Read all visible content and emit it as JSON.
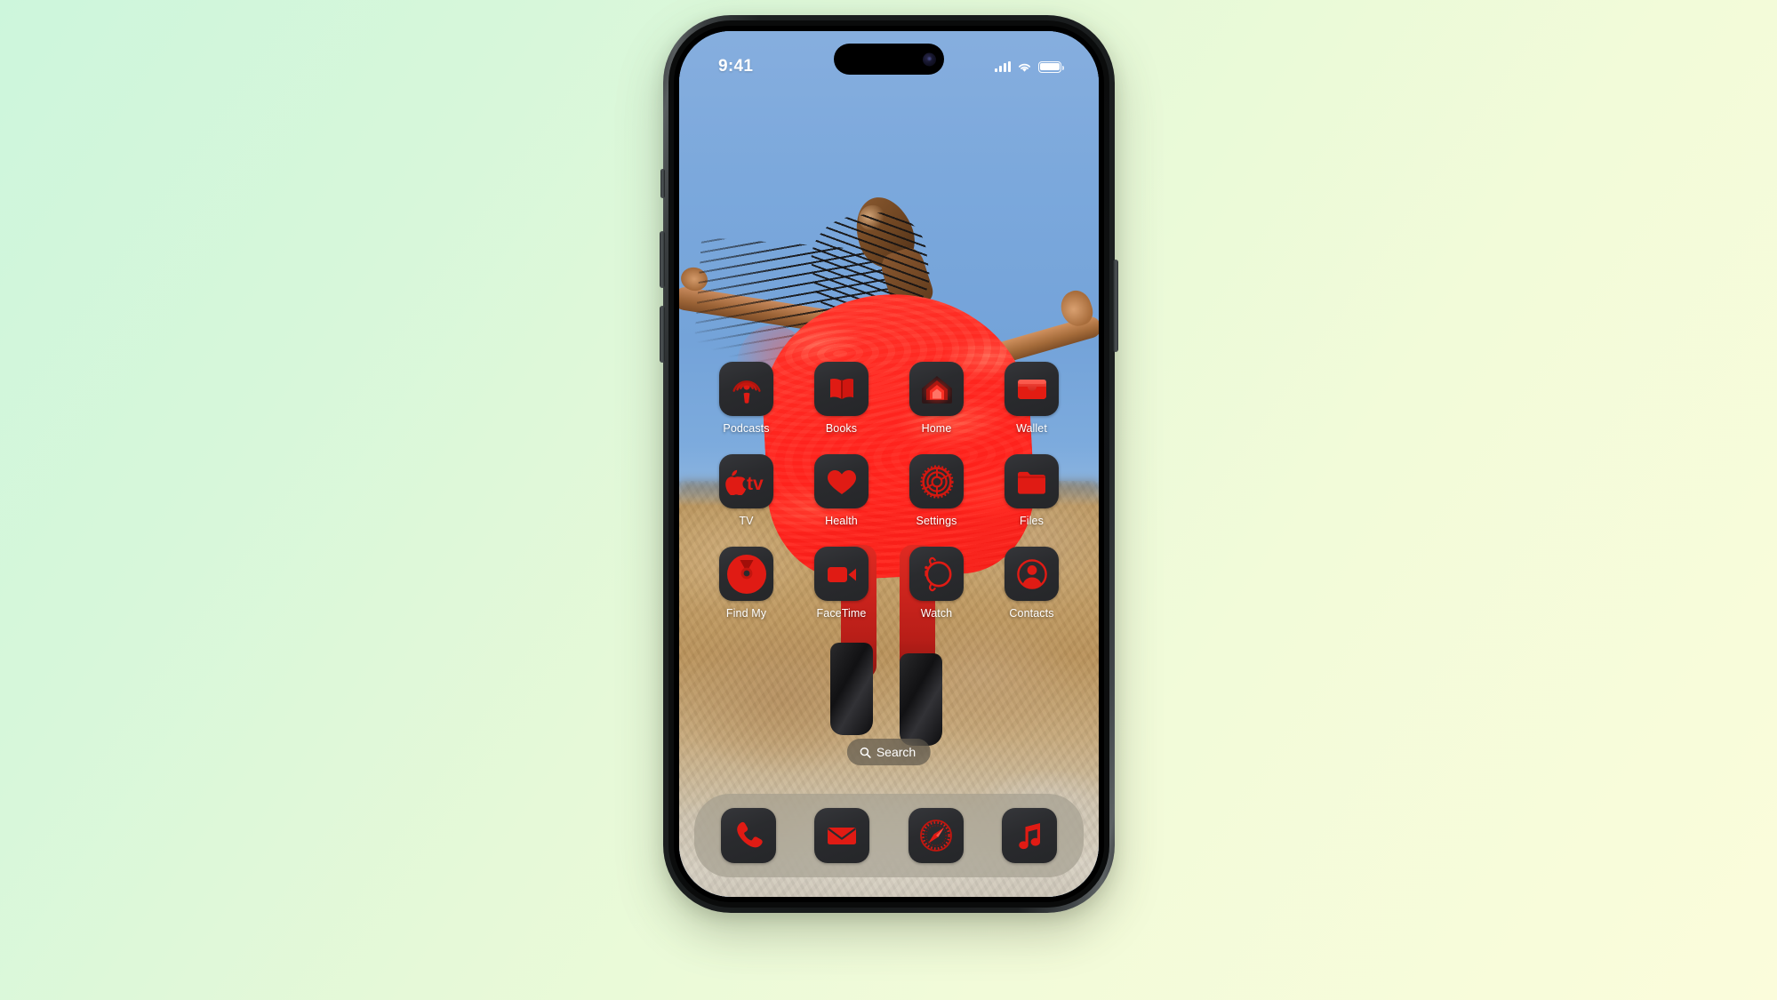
{
  "device": {
    "name": "iPhone",
    "frame_color": "#16191a"
  },
  "background": {
    "gradient_from": "#cdf6dc",
    "gradient_to": "#fbfcdb"
  },
  "status_bar": {
    "time": "9:41",
    "cellular_icon": "cellular-bars-icon",
    "wifi_icon": "wifi-icon",
    "battery_icon": "battery-icon"
  },
  "wallpaper": {
    "description": "Woman in red ruffled dress with arms outstretched against blue sky and desert rocks",
    "sky_color": "#7ea9dd",
    "dress_color": "#f5302a",
    "rock_color": "#c5a068"
  },
  "theme": {
    "icon_tint": "#e01b14",
    "icon_background": "#2a2b2e",
    "style": "dark-tinted-red"
  },
  "home_screen": {
    "rows": [
      {
        "apps": [
          {
            "label": "Podcasts",
            "icon": "podcasts-icon"
          },
          {
            "label": "Books",
            "icon": "books-icon"
          },
          {
            "label": "Home",
            "icon": "home-icon"
          },
          {
            "label": "Wallet",
            "icon": "wallet-icon"
          }
        ]
      },
      {
        "apps": [
          {
            "label": "TV",
            "icon": "appletv-icon"
          },
          {
            "label": "Health",
            "icon": "health-heart-icon"
          },
          {
            "label": "Settings",
            "icon": "settings-gear-icon"
          },
          {
            "label": "Files",
            "icon": "files-folder-icon"
          }
        ]
      },
      {
        "apps": [
          {
            "label": "Find My",
            "icon": "findmy-radar-icon"
          },
          {
            "label": "FaceTime",
            "icon": "facetime-video-icon"
          },
          {
            "label": "Watch",
            "icon": "watch-icon"
          },
          {
            "label": "Contacts",
            "icon": "contacts-person-icon"
          }
        ]
      }
    ]
  },
  "search": {
    "label": "Search",
    "icon": "search-icon"
  },
  "dock": {
    "apps": [
      {
        "label": "Phone",
        "icon": "phone-handset-icon"
      },
      {
        "label": "Mail",
        "icon": "mail-envelope-icon"
      },
      {
        "label": "Safari",
        "icon": "safari-compass-icon"
      },
      {
        "label": "Music",
        "icon": "music-note-icon"
      }
    ]
  },
  "side_buttons": [
    {
      "name": "mute-switch"
    },
    {
      "name": "volume-up-button"
    },
    {
      "name": "volume-down-button"
    },
    {
      "name": "power-button"
    }
  ]
}
